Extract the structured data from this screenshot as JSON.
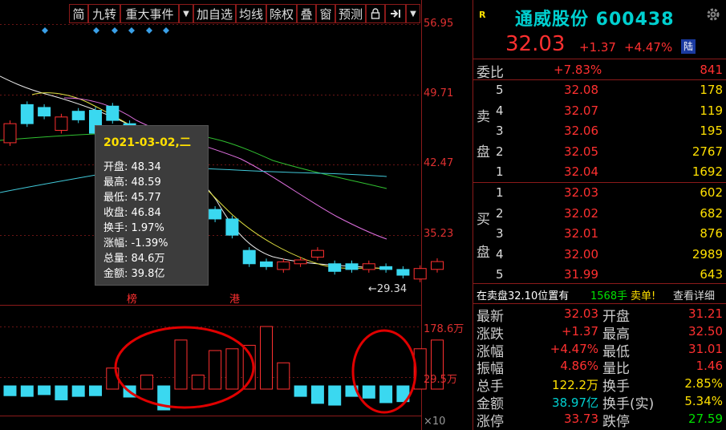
{
  "toolbar": {
    "jian": "简",
    "jiuzhuan": "九转",
    "events": "重大事件",
    "add_favorite": "加自选",
    "ma": "均线",
    "exright": "除权",
    "overlay": "叠",
    "window": "窗",
    "predict": "预测",
    "dropdown_arrow": "▼"
  },
  "axis": {
    "y_ticks": [
      "56.95",
      "49.71",
      "42.47",
      "35.23"
    ],
    "low_marker": "←29.34",
    "vol_ticks": [
      "178.6万",
      "29.5万"
    ],
    "vol_unit": "×10"
  },
  "chart_labels": {
    "bang": "榜",
    "gang": "港"
  },
  "tooltip": {
    "date": "2021-03-02,二",
    "open": "开盘: 48.34",
    "high": "最高: 48.59",
    "low": "最低: 45.77",
    "close": "收盘: 46.84",
    "turnover": "换手: 1.97%",
    "change": "涨幅: -1.39%",
    "volume": "总量: 84.6万",
    "amount": "金额: 39.8亿"
  },
  "quote": {
    "r_badge": "R",
    "name": "通威股份 600438",
    "price": "32.03",
    "change": "+1.37",
    "change_pct": "+4.47%",
    "lu_badge": "陆",
    "weibi_label": "委比",
    "weibi_pct": "+7.83%",
    "weibi_val": "841"
  },
  "orderbook": {
    "sell_label_top": "卖",
    "sell_label_bottom": "盘",
    "buy_label_top": "买",
    "buy_label_bottom": "盘",
    "sell": [
      {
        "idx": "5",
        "price": "32.08",
        "vol": "178"
      },
      {
        "idx": "4",
        "price": "32.07",
        "vol": "119"
      },
      {
        "idx": "3",
        "price": "32.06",
        "vol": "195"
      },
      {
        "idx": "2",
        "price": "32.05",
        "vol": "2767"
      },
      {
        "idx": "1",
        "price": "32.04",
        "vol": "1692"
      }
    ],
    "buy": [
      {
        "idx": "1",
        "price": "32.03",
        "vol": "602"
      },
      {
        "idx": "2",
        "price": "32.02",
        "vol": "682"
      },
      {
        "idx": "3",
        "price": "32.01",
        "vol": "876"
      },
      {
        "idx": "4",
        "price": "32.00",
        "vol": "2989"
      },
      {
        "idx": "5",
        "price": "31.99",
        "vol": "643"
      }
    ]
  },
  "notice": {
    "text": "在卖盘32.10位置有",
    "qty": "1568手",
    "tail": "卖单!",
    "link": "查看详细"
  },
  "stats": {
    "latest_label": "最新",
    "latest": "32.03",
    "open_label": "开盘",
    "open": "31.21",
    "change_label": "涨跌",
    "change": "+1.37",
    "high_label": "最高",
    "high": "32.50",
    "pct_label": "涨幅",
    "pct": "+4.47%",
    "low_label": "最低",
    "low": "31.01",
    "amp_label": "振幅",
    "amp": "4.86%",
    "volratio_label": "量比",
    "volratio": "1.46",
    "hands_label": "总手",
    "hands": "122.2万",
    "turnover_label": "换手",
    "turnover": "2.85%",
    "amount_label": "金额",
    "amount": "38.97亿",
    "turnover_real_label": "换手(实)",
    "turnover_real": "5.34%",
    "limit_up_label": "涨停",
    "limit_up": "33.73",
    "limit_down_label": "跌停",
    "limit_down": "27.59"
  },
  "chart_data": {
    "type": "candlestick",
    "y_range": [
      29.34,
      56.95
    ],
    "candles": [
      {
        "o": 44.5,
        "c": 46.5
      },
      {
        "o": 48.5,
        "c": 46.5
      },
      {
        "o": 48.2,
        "c": 47.3
      },
      {
        "o": 45.8,
        "c": 47.2
      },
      {
        "o": 47.8,
        "c": 46.9
      },
      {
        "o": 47.9,
        "c": 45.5
      },
      {
        "o": 48.34,
        "c": 46.84
      },
      {
        "o": 46.5,
        "c": 44.5
      },
      {
        "o": 44.0,
        "c": 43.0
      },
      {
        "o": 42.0,
        "c": 40.5
      },
      {
        "o": 41.0,
        "c": 39.5
      },
      {
        "o": 39.0,
        "c": 37.5
      },
      {
        "o": 37.5,
        "c": 36.5
      },
      {
        "o": 36.5,
        "c": 34.8
      },
      {
        "o": 33.2,
        "c": 31.8
      },
      {
        "o": 32.0,
        "c": 31.5
      },
      {
        "o": 31.2,
        "c": 32.0
      },
      {
        "o": 31.8,
        "c": 32.2
      },
      {
        "o": 32.5,
        "c": 33.2
      },
      {
        "o": 31.8,
        "c": 31.0
      },
      {
        "o": 31.8,
        "c": 31.2
      },
      {
        "o": 31.2,
        "c": 31.8
      },
      {
        "o": 31.5,
        "c": 31.2
      },
      {
        "o": 31.2,
        "c": 30.6
      },
      {
        "o": 30.2,
        "c": 31.3
      },
      {
        "o": 31.21,
        "c": 32.03
      }
    ],
    "volumes": [
      {
        "v": 28,
        "up": false
      },
      {
        "v": 30,
        "up": false
      },
      {
        "v": 25,
        "up": false
      },
      {
        "v": 40,
        "up": false
      },
      {
        "v": 30,
        "up": false
      },
      {
        "v": 28,
        "up": false
      },
      {
        "v": 60,
        "up": true
      },
      {
        "v": 32,
        "up": false
      },
      {
        "v": 40,
        "up": true
      },
      {
        "v": 75,
        "up": false
      },
      {
        "v": 140,
        "up": true
      },
      {
        "v": 40,
        "up": true
      },
      {
        "v": 110,
        "up": true
      },
      {
        "v": 115,
        "up": true
      },
      {
        "v": 125,
        "up": true
      },
      {
        "v": 178.6,
        "up": true
      },
      {
        "v": 75,
        "up": true
      },
      {
        "v": 30,
        "up": false
      },
      {
        "v": 50,
        "up": false
      },
      {
        "v": 55,
        "up": false
      },
      {
        "v": 30,
        "up": false
      },
      {
        "v": 35,
        "up": false
      },
      {
        "v": 48,
        "up": false
      },
      {
        "v": 45,
        "up": false
      },
      {
        "v": 115,
        "up": true
      },
      {
        "v": 140,
        "up": true
      }
    ]
  }
}
